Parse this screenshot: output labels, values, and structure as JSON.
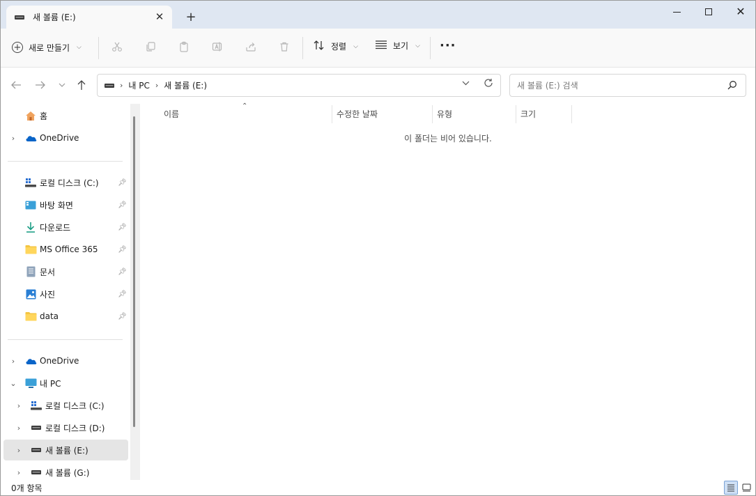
{
  "window": {
    "tab_title": "새 볼륨 (E:)",
    "new_tab": "+",
    "minimize": "─",
    "maximize": "□",
    "close": "✕"
  },
  "toolbar": {
    "new_label": "새로 만들기",
    "sort_label": "정렬",
    "view_label": "보기",
    "more": "···",
    "icons": [
      "cut-icon",
      "copy-icon",
      "paste-icon",
      "rename-icon",
      "share-icon",
      "delete-icon"
    ]
  },
  "address": {
    "crumbs": [
      "내 PC",
      "새 볼륨 (E:)"
    ]
  },
  "search": {
    "placeholder": "새 볼륨 (E:) 검색"
  },
  "sidebar": {
    "home": "홈",
    "onedrive_top": "OneDrive",
    "quick_access": [
      {
        "label": "로컬 디스크 (C:)",
        "icon": "disk-c-icon"
      },
      {
        "label": "바탕 화면",
        "icon": "desktop-icon"
      },
      {
        "label": "다운로드",
        "icon": "download-icon"
      },
      {
        "label": "MS Office 365",
        "icon": "folder-icon"
      },
      {
        "label": "문서",
        "icon": "document-icon"
      },
      {
        "label": "사진",
        "icon": "pictures-icon"
      },
      {
        "label": "data",
        "icon": "folder-icon"
      }
    ],
    "tree": {
      "onedrive": "OneDrive",
      "this_pc": "내 PC",
      "drives": [
        "로컬 디스크 (C:)",
        "로컬 디스크 (D:)",
        "새 볼륨 (E:)",
        "새 볼륨 (G:)"
      ]
    }
  },
  "content": {
    "columns": [
      "이름",
      "수정한 날짜",
      "유형",
      "크기"
    ],
    "empty_message": "이 폴더는 비어 있습니다."
  },
  "status": {
    "item_count": "0개 항목"
  },
  "colors": {
    "titlebar": "#dfe7f2",
    "selected": "#e5e5e5",
    "accent": "#0067c0"
  }
}
